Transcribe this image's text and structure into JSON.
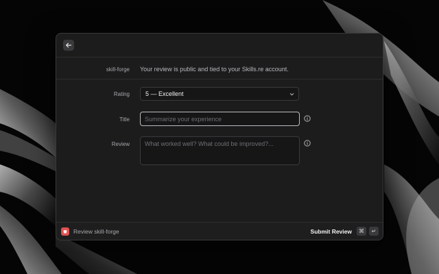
{
  "header": {
    "back_icon": "arrow-left-icon"
  },
  "info": {
    "skill_name": "skill-forge",
    "notice": "Your review is public and tied to your Skills.re account."
  },
  "form": {
    "rating": {
      "label": "Rating",
      "selected": "5 — Excellent",
      "icon": "chevron-down-icon"
    },
    "title": {
      "label": "Title",
      "value": "",
      "placeholder": "Summarize your experience",
      "help_icon": "info-icon"
    },
    "review": {
      "label": "Review",
      "value": "",
      "placeholder": "What worked well? What could be improved?...",
      "help_icon": "info-icon"
    }
  },
  "footer": {
    "app_icon": "app-icon",
    "title": "Review skill-forge",
    "submit_label": "Submit Review",
    "shortcut_cmd": "⌘",
    "shortcut_enter": "↵"
  },
  "colors": {
    "window_bg": "#1c1c1d",
    "accent_red": "#e05252",
    "border": "#3a3a3c"
  }
}
